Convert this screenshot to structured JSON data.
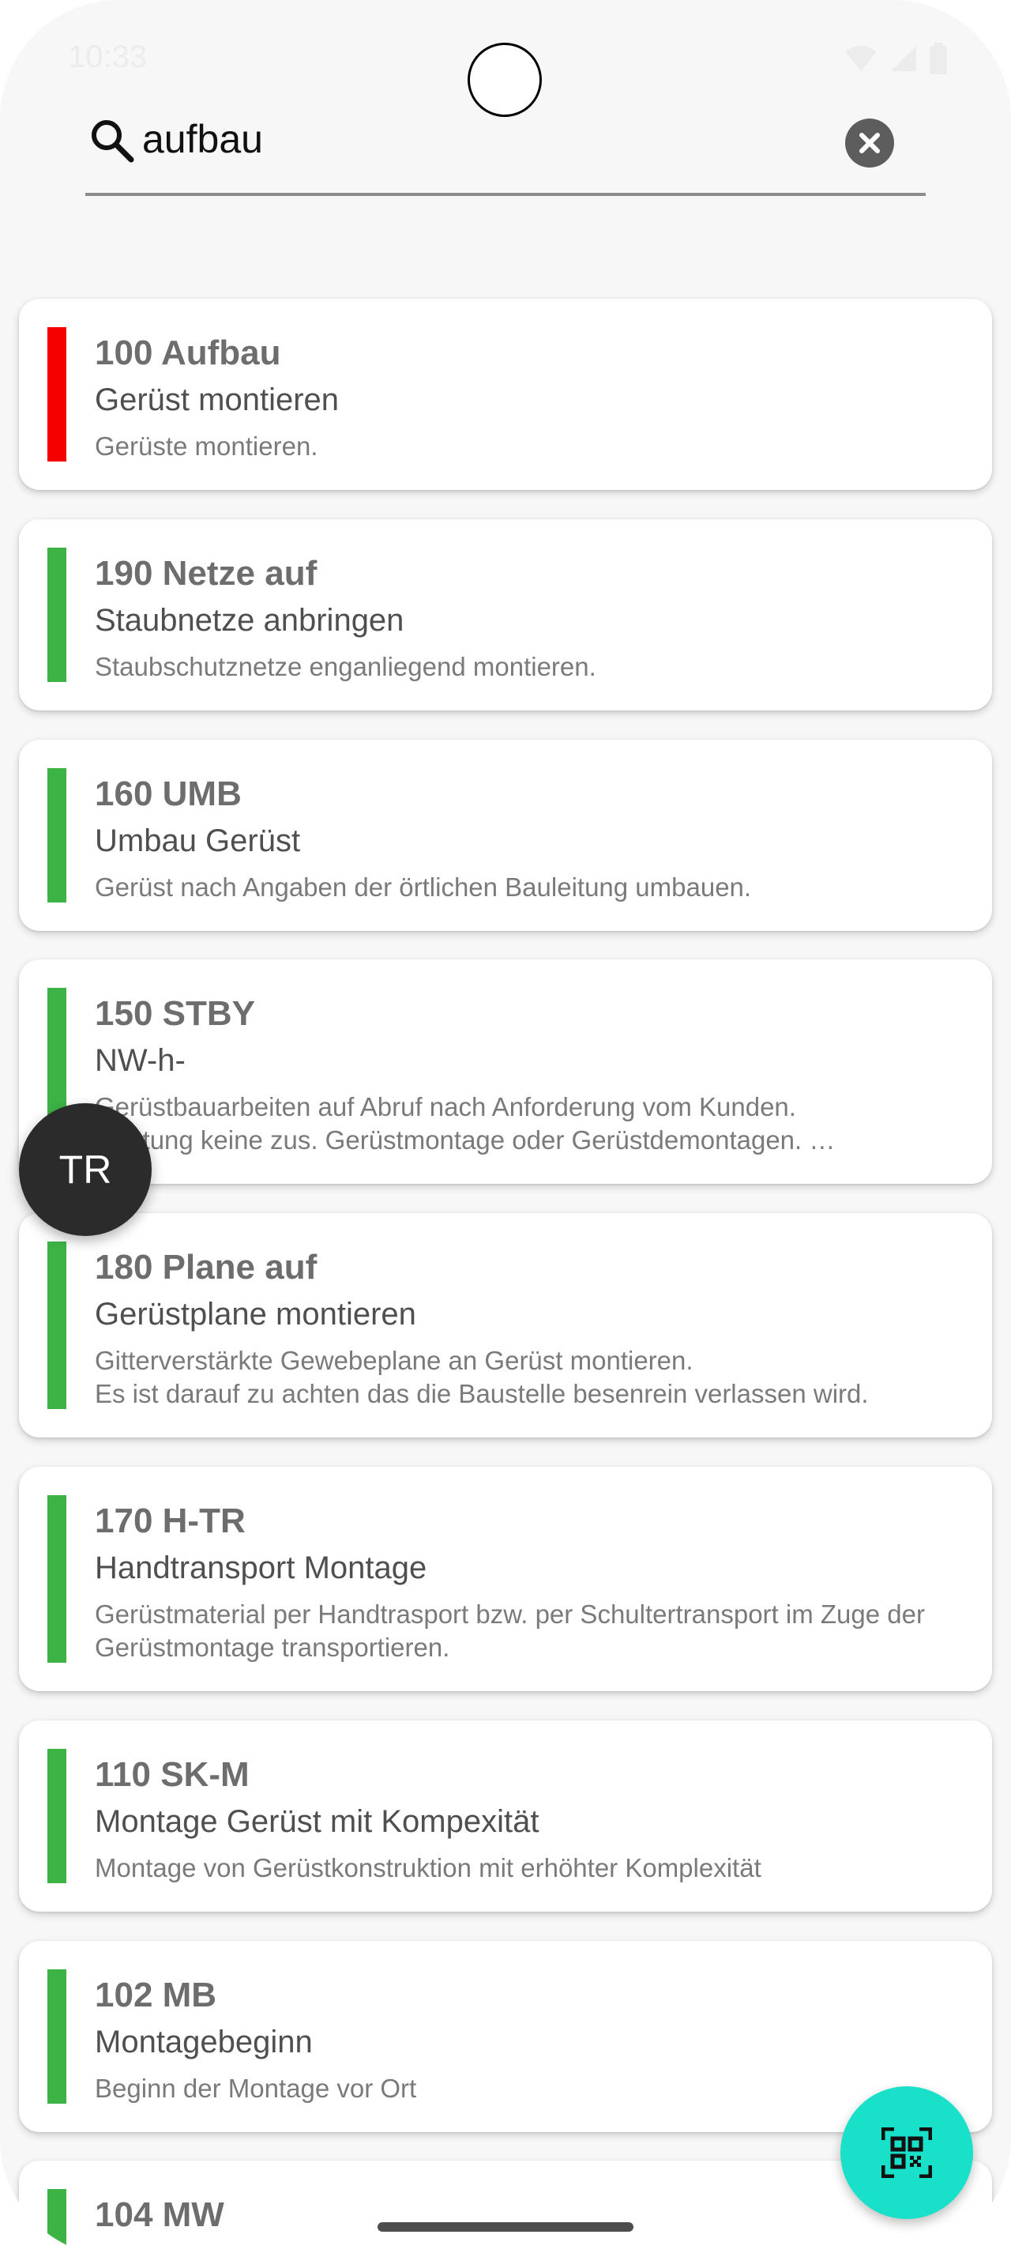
{
  "status_bar": {
    "time": "10:33",
    "icons": [
      "wifi-icon",
      "signal-icon",
      "battery-icon"
    ]
  },
  "search": {
    "value": "aufbau",
    "icon": "search-icon",
    "clear_icon": "clear-icon"
  },
  "items": [
    {
      "code": "100 Aufbau",
      "title": "Gerüst montieren",
      "description": "Gerüste montieren.",
      "status_color": "#f50000"
    },
    {
      "code": "190 Netze auf",
      "title": "Staubnetze anbringen",
      "description": "Staubschutznetze enganliegend montieren.",
      "status_color": "#3db346"
    },
    {
      "code": "160 UMB",
      "title": "Umbau Gerüst",
      "description": "Gerüst nach Angaben der örtlichen Bauleitung umbauen.",
      "status_color": "#3db346"
    },
    {
      "code": "150 STBY",
      "title": "NW-h-",
      "description": "Gerüstbauarbeiten auf Abruf nach Anforderung vom Kunden.\nLeistung keine zus. Gerüstmontage oder Gerüstdemontagen. …",
      "status_color": "#3db346"
    },
    {
      "code": "180 Plane auf",
      "title": "Gerüstplane montieren",
      "description": "Gitterverstärkte Gewebeplane an Gerüst montieren.\nEs ist darauf zu achten das die Baustelle besenrein verlassen wird.",
      "status_color": "#3db346"
    },
    {
      "code": "170 H-TR",
      "title": "Handtransport Montage",
      "description": "Gerüstmaterial per Handtrasport bzw. per Schultertransport im Zuge der Gerüstmontage transportieren.",
      "status_color": "#3db346"
    },
    {
      "code": "110 SK-M",
      "title": "Montage Gerüst mit Kompexität",
      "description": "Montage von Gerüstkonstruktion mit erhöhter Komplexität",
      "status_color": "#3db346"
    },
    {
      "code": "102 MB",
      "title": "Montagebeginn",
      "description": "Beginn der Montage vor Ort",
      "status_color": "#3db346"
    },
    {
      "code": "104 MW",
      "title": "",
      "description": "",
      "status_color": "#3db346"
    }
  ],
  "avatar": {
    "initials": "TR"
  },
  "fab": {
    "icon": "qr-scan-icon"
  }
}
